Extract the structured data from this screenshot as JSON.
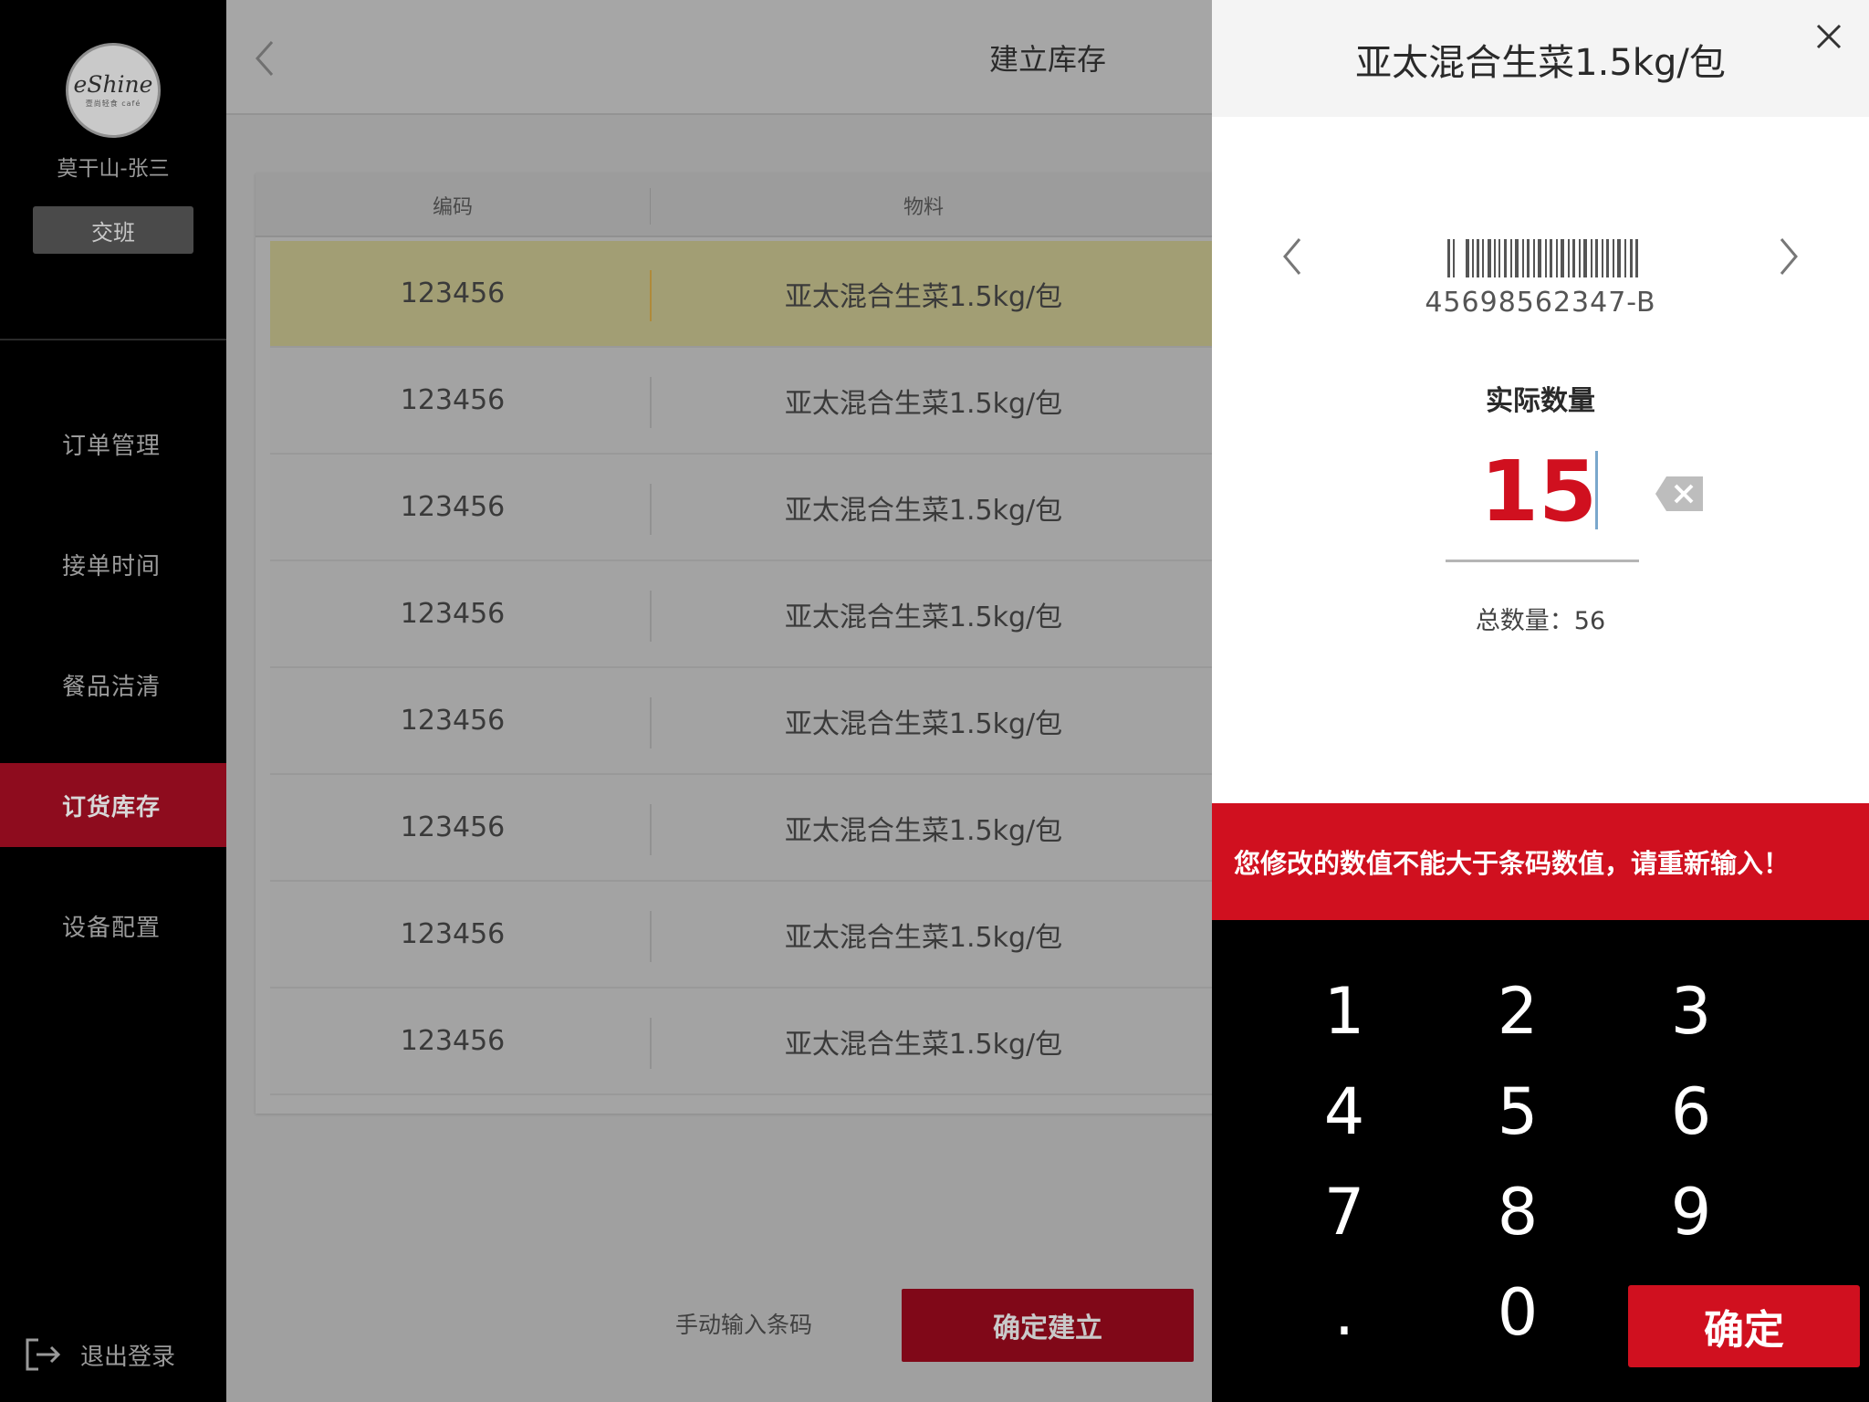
{
  "sidebar": {
    "logo_text": "eShine",
    "logo_subtext": "壹尚轻食 café",
    "user_name": "莫干山-张三",
    "shift_button": "交班",
    "nav_items": [
      {
        "label": "订单管理"
      },
      {
        "label": "接单时间"
      },
      {
        "label": "餐品洁清"
      },
      {
        "label": "订货库存",
        "active": true
      },
      {
        "label": "设备配置"
      }
    ],
    "logout_label": "退出登录"
  },
  "main": {
    "title": "建立库存",
    "table": {
      "headers": [
        "编码",
        "物料"
      ],
      "rows": [
        {
          "code": "123456",
          "material": "亚太混合生菜1.5kg/包",
          "selected": true
        },
        {
          "code": "123456",
          "material": "亚太混合生菜1.5kg/包"
        },
        {
          "code": "123456",
          "material": "亚太混合生菜1.5kg/包"
        },
        {
          "code": "123456",
          "material": "亚太混合生菜1.5kg/包"
        },
        {
          "code": "123456",
          "material": "亚太混合生菜1.5kg/包"
        },
        {
          "code": "123456",
          "material": "亚太混合生菜1.5kg/包"
        },
        {
          "code": "123456",
          "material": "亚太混合生菜1.5kg/包"
        },
        {
          "code": "123456",
          "material": "亚太混合生菜1.5kg/包"
        }
      ]
    },
    "manual_entry_label": "手动输入条码",
    "confirm_create_label": "确定建立"
  },
  "panel": {
    "title": "亚太混合生菜1.5kg/包",
    "barcode": "45698562347-B",
    "qty_label": "实际数量",
    "qty_value": "15",
    "total_label": "总数量：56",
    "error_message": "您修改的数值不能大于条码数值，请重新输入！",
    "keypad": [
      "1",
      "2",
      "3",
      "4",
      "5",
      "6",
      "7",
      "8",
      "9",
      ".",
      "0"
    ],
    "confirm_label": "确定"
  },
  "colors": {
    "accent_red": "#d0101f",
    "active_nav": "#8e0c1e",
    "selected_row": "#a29e74"
  }
}
